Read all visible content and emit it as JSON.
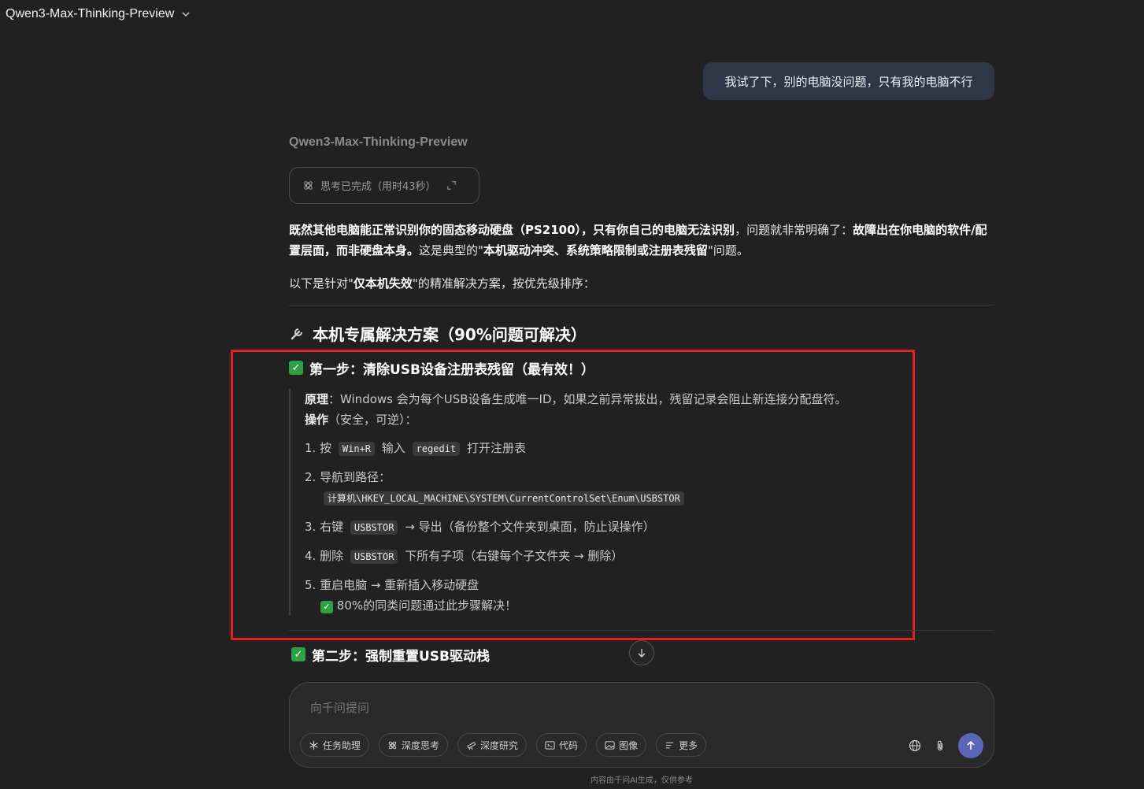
{
  "header": {
    "model_name": "Qwen3-Max-Thinking-Preview"
  },
  "user_message": "我试了下，别的电脑没问题，只有我的电脑不行",
  "assistant": {
    "model_name": "Qwen3-Max-Thinking-Preview",
    "thinking_status": "思考已完成（用时43秒）",
    "intro": {
      "p1_b1": "既然其他电脑能正常识别你的固态移动硬盘（PS2100），只有你自己的电脑无法识别",
      "p1_t1": "，问题就非常明确了：",
      "p1_b2": "故障出在你电脑的软件/配置层面，而非硬盘本身。",
      "p1_t2": "这是典型的\"",
      "p1_b3": "本机驱动冲突、系统策略限制或注册表残留",
      "p1_t3": "\"问题。",
      "p2_t1": "以下是针对\"",
      "p2_b1": "仅本机失效",
      "p2_t2": "\"的精准解决方案，按优先级排序："
    },
    "section_title": "本机专属解决方案（90%问题可解决）",
    "step1": {
      "title": "第一步：清除USB设备注册表残留（最有效！）",
      "principle_label": "原理",
      "principle_text": "：Windows 会为每个USB设备生成唯一ID，如果之前异常拔出，残留记录会阻止新连接分配盘符。",
      "op_label": "操作",
      "op_text": "（安全，可逆）：",
      "items": {
        "i1_a": "1. 按",
        "i1_code1": "Win+R",
        "i1_b": "输入",
        "i1_code2": "regedit",
        "i1_c": "打开注册表",
        "i2_a": "2. 导航到路径：",
        "i2_code": "计算机\\HKEY_LOCAL_MACHINE\\SYSTEM\\CurrentControlSet\\Enum\\USBSTOR",
        "i3_a": "3. 右键",
        "i3_code": "USBSTOR",
        "i3_b": "→ 导出（备份整个文件夹到桌面，防止误操作）",
        "i4_a": "4. 删除",
        "i4_code": "USBSTOR",
        "i4_b": "下所有子项（右键每个子文件夹 → 删除）",
        "i5_a": "5. 重启电脑 → 重新插入移动硬盘",
        "i5_note": "80%的同类问题通过此步骤解决！"
      }
    },
    "step2": {
      "title": "第二步：强制重置USB驱动栈"
    }
  },
  "composer": {
    "placeholder": "向千问提问",
    "tools": [
      "任务助理",
      "深度思考",
      "深度研究",
      "代码",
      "图像",
      "更多"
    ]
  },
  "footer": "内容由千问AI生成，仅供参考",
  "colors": {
    "background": "#212121",
    "accent": "#5b66b8",
    "highlight_box": "#e02020",
    "check": "#2ea043"
  }
}
